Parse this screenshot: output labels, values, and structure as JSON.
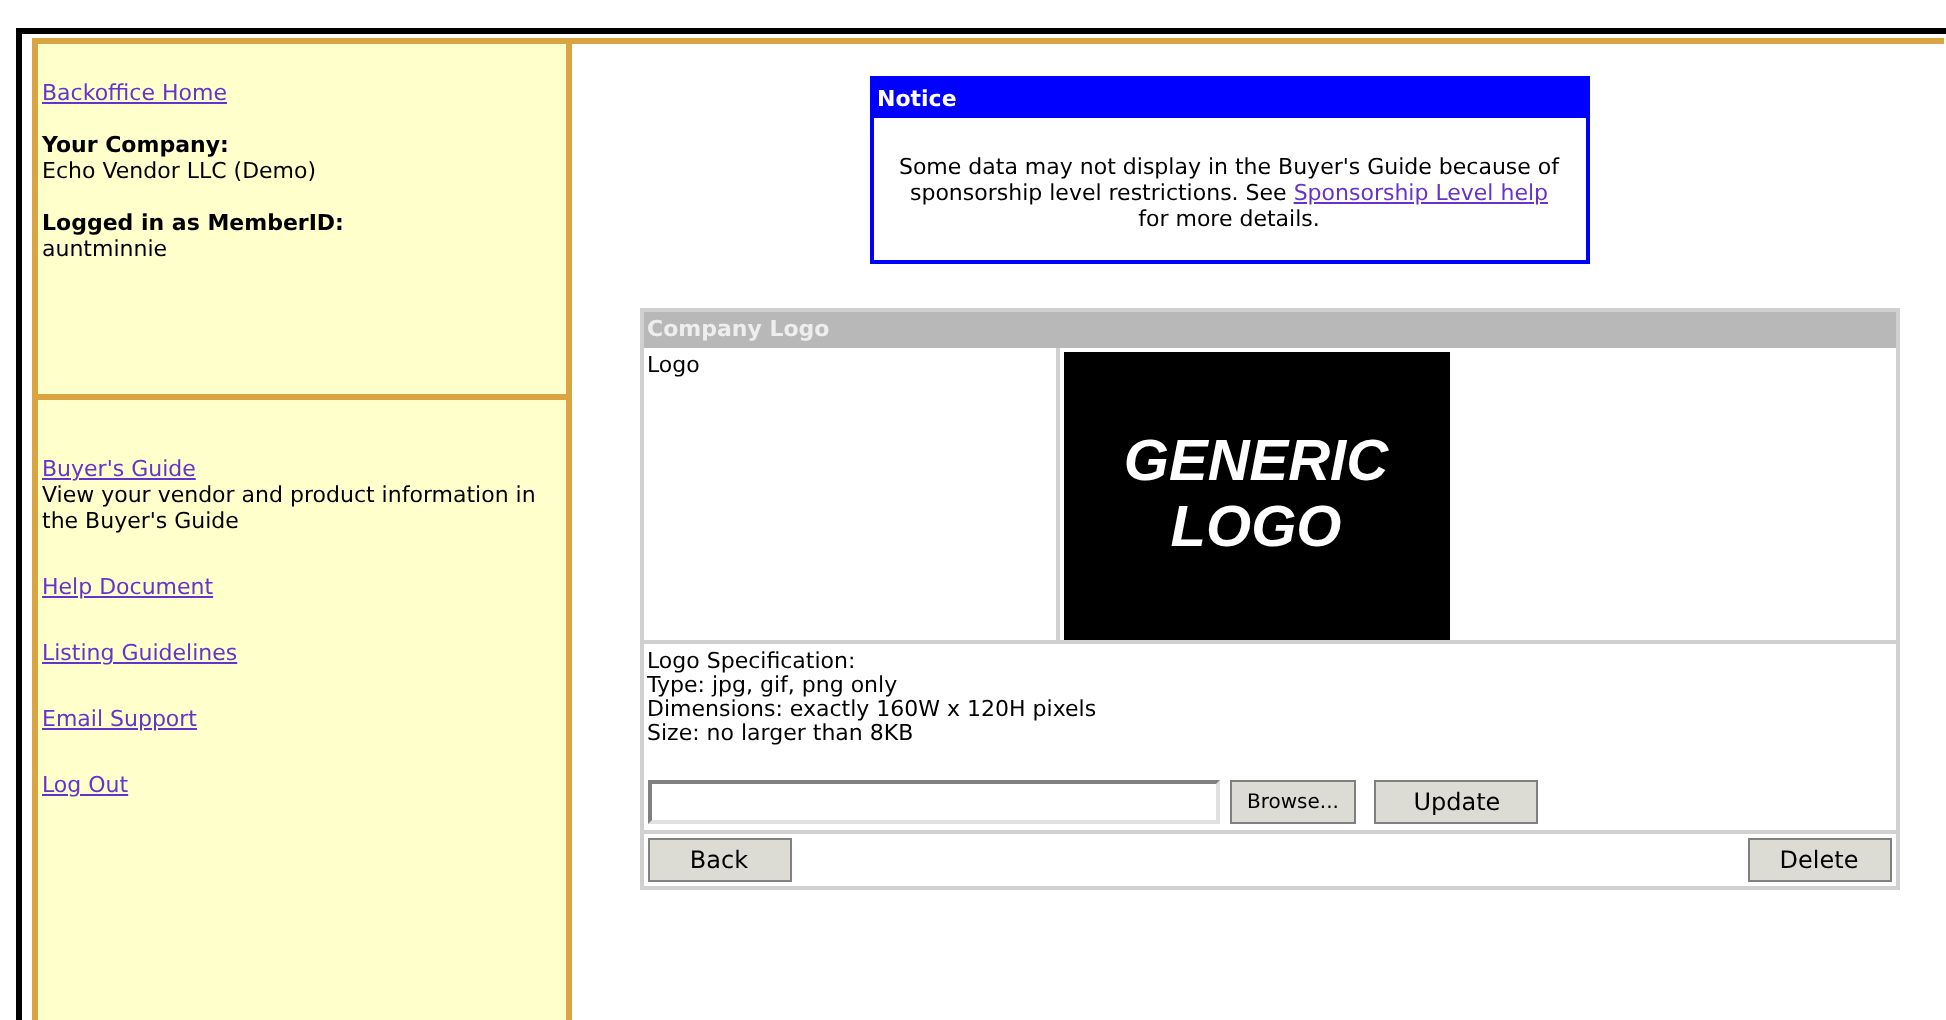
{
  "sidebar": {
    "home_link": "Backoffice Home",
    "company_label": "Your Company:",
    "company_value": "Echo Vendor LLC (Demo)",
    "member_label": "Logged in as MemberID:",
    "member_value": "auntminnie",
    "links": [
      {
        "label": "Buyer's Guide",
        "description": "View your vendor and product information in the Buyer's Guide"
      },
      {
        "label": "Help Document"
      },
      {
        "label": "Listing Guidelines"
      },
      {
        "label": "Email Support"
      },
      {
        "label": "Log Out"
      }
    ]
  },
  "notice": {
    "title": "Notice",
    "text_before": "Some data may not display in the Buyer's Guide because of sponsorship level restrictions. See",
    "link": "Sponsorship Level help",
    "text_after": "for more details."
  },
  "logo_panel": {
    "title": "Company Logo",
    "logo_label": "Logo",
    "logo_text": [
      "GENERIC",
      "LOGO"
    ],
    "spec_lines": [
      "Logo Specification:",
      "Type: jpg, gif, png only",
      "Dimensions: exactly 160W x 120H pixels",
      "Size: no larger than 8KB"
    ],
    "browse_button": "Browse...",
    "update_button": "Update",
    "back_button": "Back",
    "delete_button": "Delete"
  }
}
